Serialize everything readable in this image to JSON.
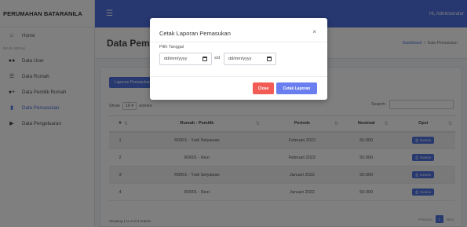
{
  "brand": "PERUMAHAN BATARANILA",
  "sidebar": {
    "home": "Home",
    "heading": "MAIN MENU",
    "items": [
      {
        "label": "Data User",
        "icon": "users-icon"
      },
      {
        "label": "Data Rumah",
        "icon": "list-icon"
      },
      {
        "label": "Data Pemilik Rumah",
        "icon": "user-plus-icon"
      },
      {
        "label": "Data Pemasukan",
        "icon": "file-icon"
      },
      {
        "label": "Data Pengeluaran",
        "icon": "arrow-right-icon"
      }
    ]
  },
  "topbar": {
    "user": "Hi, Administrator"
  },
  "page": {
    "title": "Data Pemasukan",
    "breadcrumb": [
      "Dashboard",
      "Data Pemasukan"
    ]
  },
  "card": {
    "add_button": "Laporan Pemasukan",
    "show_label": "Show",
    "show_value": "10",
    "entries_label": "entries",
    "search_label": "Search:"
  },
  "table": {
    "headers": [
      "#",
      "Rumah - Pemilik",
      "Periode",
      "Nominal",
      "Opsi"
    ],
    "rows": [
      {
        "no": "1",
        "rumah": "R0001 - Yudi Setyawan",
        "periode": "Februari 2022",
        "nominal": "50.000",
        "opsi": "Invoice"
      },
      {
        "no": "2",
        "rumah": "R0001 - Rezi",
        "periode": "Februari 2022",
        "nominal": "50.000",
        "opsi": "Invoice"
      },
      {
        "no": "3",
        "rumah": "R0001 - Yudi Setyawan",
        "periode": "Januari 2022",
        "nominal": "50.000",
        "opsi": "Invoice"
      },
      {
        "no": "4",
        "rumah": "R0001 - Rezi",
        "periode": "Januari 2022",
        "nominal": "50.000",
        "opsi": "Invoice"
      }
    ],
    "info": "Showing 1 to 4 of 4 entries",
    "pager": {
      "prev": "Previous",
      "page": "1",
      "next": "Next"
    }
  },
  "modal": {
    "title": "Cetak Laporan Pemasukan",
    "close_symbol": "×",
    "label": "Pilih Tanggal",
    "date_from_placeholder": "dd/mm/yyyy",
    "sd": "s/d",
    "date_to_placeholder": "dd/mm/yyyy",
    "close_button": "Close",
    "print_button": "Cetak Laporan"
  },
  "colors": {
    "primary": "#4e73df",
    "topbar": "#4e6fe0",
    "danger": "#f25c54",
    "print": "#6a7ef0"
  }
}
